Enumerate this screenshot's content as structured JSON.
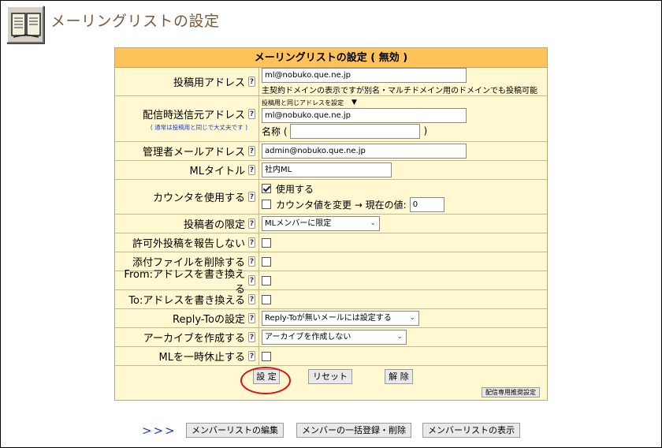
{
  "page_title": "メーリングリストの設定",
  "settings": {
    "header": "メーリングリストの設定 ( 無効 )",
    "help_glyph": "?",
    "posting_address": {
      "label": "投稿用アドレス",
      "value": "ml@nobuko.que.ne.jp",
      "note": "主契約ドメインの表示ですが別名・マルチドメイン用のドメインでも投稿可能"
    },
    "delivery_from": {
      "label": "配信時送信元アドレス",
      "note": "( 通常は投稿用と同じで大丈夫です )",
      "same_as_posting": "投稿用と同じアドレスを設定",
      "dropdown_arrow": "▼",
      "value": "ml@nobuko.que.ne.jp",
      "name_label": "名称 (",
      "name_value": "",
      "name_close": ")"
    },
    "admin_address": {
      "label": "管理者メールアドレス",
      "value": "admin@nobuko.que.ne.jp"
    },
    "ml_title": {
      "label": "MLタイトル",
      "value": "社内ML"
    },
    "counter": {
      "label": "カウンタを使用する",
      "use_label": "使用する",
      "use_checked": true,
      "change_label": "カウンタ値を変更 → 現在の値:",
      "change_checked": false,
      "current_value": "0"
    },
    "poster_restriction": {
      "label": "投稿者の限定",
      "selected": "MLメンバーに限定"
    },
    "report_unauthorized": {
      "label": "許可外投稿を報告しない",
      "checked": false
    },
    "delete_attachments": {
      "label": "添付ファイルを削除する",
      "checked": false
    },
    "rewrite_from": {
      "label": "From:アドレスを書き換える",
      "checked": false
    },
    "rewrite_to": {
      "label": "To:アドレスを書き換える",
      "checked": false
    },
    "reply_to": {
      "label": "Reply-Toの設定",
      "selected": "Reply-Toが無いメールには設定する"
    },
    "archive": {
      "label": "アーカイブを作成する",
      "selected": "アーカイブを作成しない"
    },
    "pause": {
      "label": "MLを一時休止する",
      "checked": false
    },
    "buttons": {
      "set": "設 定",
      "reset": "リセット",
      "release": "解 除",
      "delivery_only": "配信専用推奨設定"
    }
  },
  "bottom_nav": {
    "arrows": ">>>",
    "edit_members": "メンバーリストの編集",
    "bulk_members": "メンバーの一括登録・削除",
    "show_members": "メンバーリストの表示"
  },
  "colors": {
    "header_bg": "#ffc35a",
    "table_bg": "#fff8d0",
    "title_color": "#7a5a3a",
    "highlight_circle": "#e01010",
    "link_blue": "#1f3dbf"
  }
}
